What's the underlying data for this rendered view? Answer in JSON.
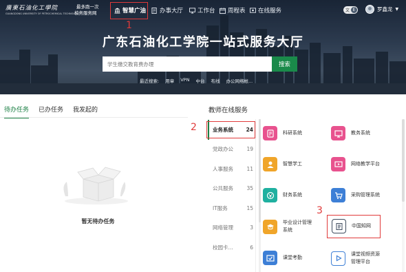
{
  "header": {
    "logo_cn": "廣東石油化工學院",
    "logo_en": "GUANGDONG UNIVERSITY OF PETROCHEMICAL TECHNOLOGY",
    "slogan_line1": "最多跑一次",
    "slogan_line2": "校务服务网",
    "nav": [
      {
        "label": "智慧广油",
        "icon": "bank-icon",
        "active": true
      },
      {
        "label": "办事大厅",
        "icon": "document-icon",
        "active": false
      },
      {
        "label": "工作台",
        "icon": "monitor-icon",
        "active": false
      },
      {
        "label": "周程表",
        "icon": "calendar-icon",
        "active": false
      },
      {
        "label": "在线服务",
        "icon": "online-service-icon",
        "active": false
      }
    ],
    "lang_text": "文",
    "lang_badge": "E",
    "user_name": "罗鑫龙"
  },
  "hero": {
    "title": "广东石油化工学院一站式服务大厅",
    "search_placeholder": "学生缴交教育费办理",
    "search_button": "搜索",
    "recent_label": "最近搜索:",
    "recent_items": [
      "用章",
      "VPN",
      "中台",
      "布线",
      "办公网络帐..."
    ]
  },
  "tasks": {
    "tabs": [
      "待办任务",
      "已办任务",
      "我发起的"
    ],
    "active_tab": 0,
    "empty_text": "暂无待办任务"
  },
  "services": {
    "title": "教师在线服务",
    "categories": [
      {
        "label": "业务系统",
        "count": "24",
        "active": true
      },
      {
        "label": "党政办公",
        "count": "19",
        "active": false
      },
      {
        "label": "人事服务",
        "count": "11",
        "active": false
      },
      {
        "label": "公共服务",
        "count": "35",
        "active": false
      },
      {
        "label": "IT服务",
        "count": "15",
        "active": false
      },
      {
        "label": "网络管理",
        "count": "3",
        "active": false
      },
      {
        "label": "校园卡...",
        "count": "6",
        "active": false
      }
    ],
    "systems": [
      {
        "label": "科研系统",
        "icon": "research-icon",
        "color": "#e8528e"
      },
      {
        "label": "教务系统",
        "icon": "teaching-icon",
        "color": "#e8528e"
      },
      {
        "label": "智慧学工",
        "icon": "student-work-icon",
        "color": "#f0a52a"
      },
      {
        "label": "网络教学平台",
        "icon": "online-teaching-icon",
        "color": "#e8528e"
      },
      {
        "label": "财务系统",
        "icon": "finance-icon",
        "color": "#1fb0a0"
      },
      {
        "label": "采购管理系统",
        "icon": "cart-icon",
        "color": "#3d7fd6"
      },
      {
        "label": "毕业设计管理系统",
        "icon": "graduation-icon",
        "color": "#f0a52a"
      },
      {
        "label": "中国知网",
        "icon": "cnki-icon",
        "color": "#3d4a5c"
      },
      {
        "label": "课堂考勤",
        "icon": "attendance-icon",
        "color": "#3d7fd6"
      },
      {
        "label": "课堂视频资源管理平台",
        "icon": "video-icon",
        "color": "#3d7fd6"
      }
    ]
  },
  "annotations": [
    "1",
    "2",
    "3"
  ]
}
